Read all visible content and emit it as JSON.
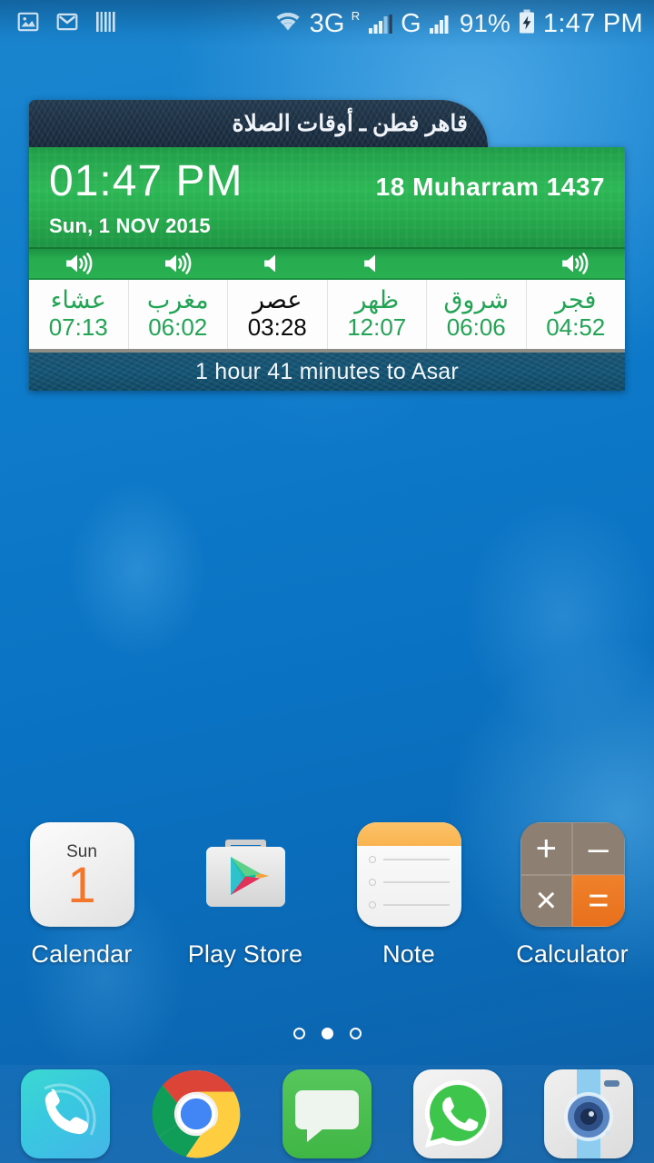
{
  "status_bar": {
    "left_icons": [
      {
        "name": "screenshot-icon",
        "label": "screenshot"
      },
      {
        "name": "gmail-icon",
        "label": "gmail"
      },
      {
        "name": "barcode-icon",
        "label": "barcode"
      }
    ],
    "wifi": "wifi-icon",
    "sim1_network": "3G",
    "sim1_roaming": "R",
    "sim1_index": "1",
    "sim2_network": "G",
    "sim2_index": "2",
    "battery_percent": "91%",
    "battery_state": "charging",
    "clock": "1:47 PM"
  },
  "widget": {
    "title": "قاهر فطن ـ أوقات الصلاة",
    "clock": "01:47 PM",
    "hijri_date": "18  Muharram  1437",
    "gregorian_date": "Sun, 1 NOV 2015",
    "countdown": "1 hour 41 minutes to Asar",
    "accent_green": "#29b051",
    "header_dark": "#1b2f42",
    "footer_blue": "#115070",
    "next_prayer_color": "#0b0b0b",
    "prayers": [
      {
        "name": "عشاء",
        "time": "07:13",
        "sound": "on",
        "next": false
      },
      {
        "name": "مغرب",
        "time": "06:02",
        "sound": "on",
        "next": false
      },
      {
        "name": "عصر",
        "time": "03:28",
        "sound": "off",
        "next": true
      },
      {
        "name": "ظهر",
        "time": "12:07",
        "sound": "off",
        "next": false
      },
      {
        "name": "شروق",
        "time": "06:06",
        "sound": "none",
        "next": false
      },
      {
        "name": "فجر",
        "time": "04:52",
        "sound": "on",
        "next": false
      }
    ]
  },
  "apps": [
    {
      "label": "Calendar",
      "icon": "calendar-icon",
      "day_of_week": "Sun",
      "day": "1"
    },
    {
      "label": "Play Store",
      "icon": "play-store-icon"
    },
    {
      "label": "Note",
      "icon": "note-icon"
    },
    {
      "label": "Calculator",
      "icon": "calculator-icon",
      "keys": [
        "+",
        "–",
        "×",
        "="
      ]
    }
  ],
  "page_indicator": {
    "count": 3,
    "active_index": 1
  },
  "dock": [
    {
      "label": "Phone",
      "icon": "phone-icon"
    },
    {
      "label": "Chrome",
      "icon": "chrome-icon"
    },
    {
      "label": "Messages",
      "icon": "messages-icon"
    },
    {
      "label": "WhatsApp",
      "icon": "whatsapp-icon"
    },
    {
      "label": "Camera",
      "icon": "camera-icon"
    }
  ]
}
